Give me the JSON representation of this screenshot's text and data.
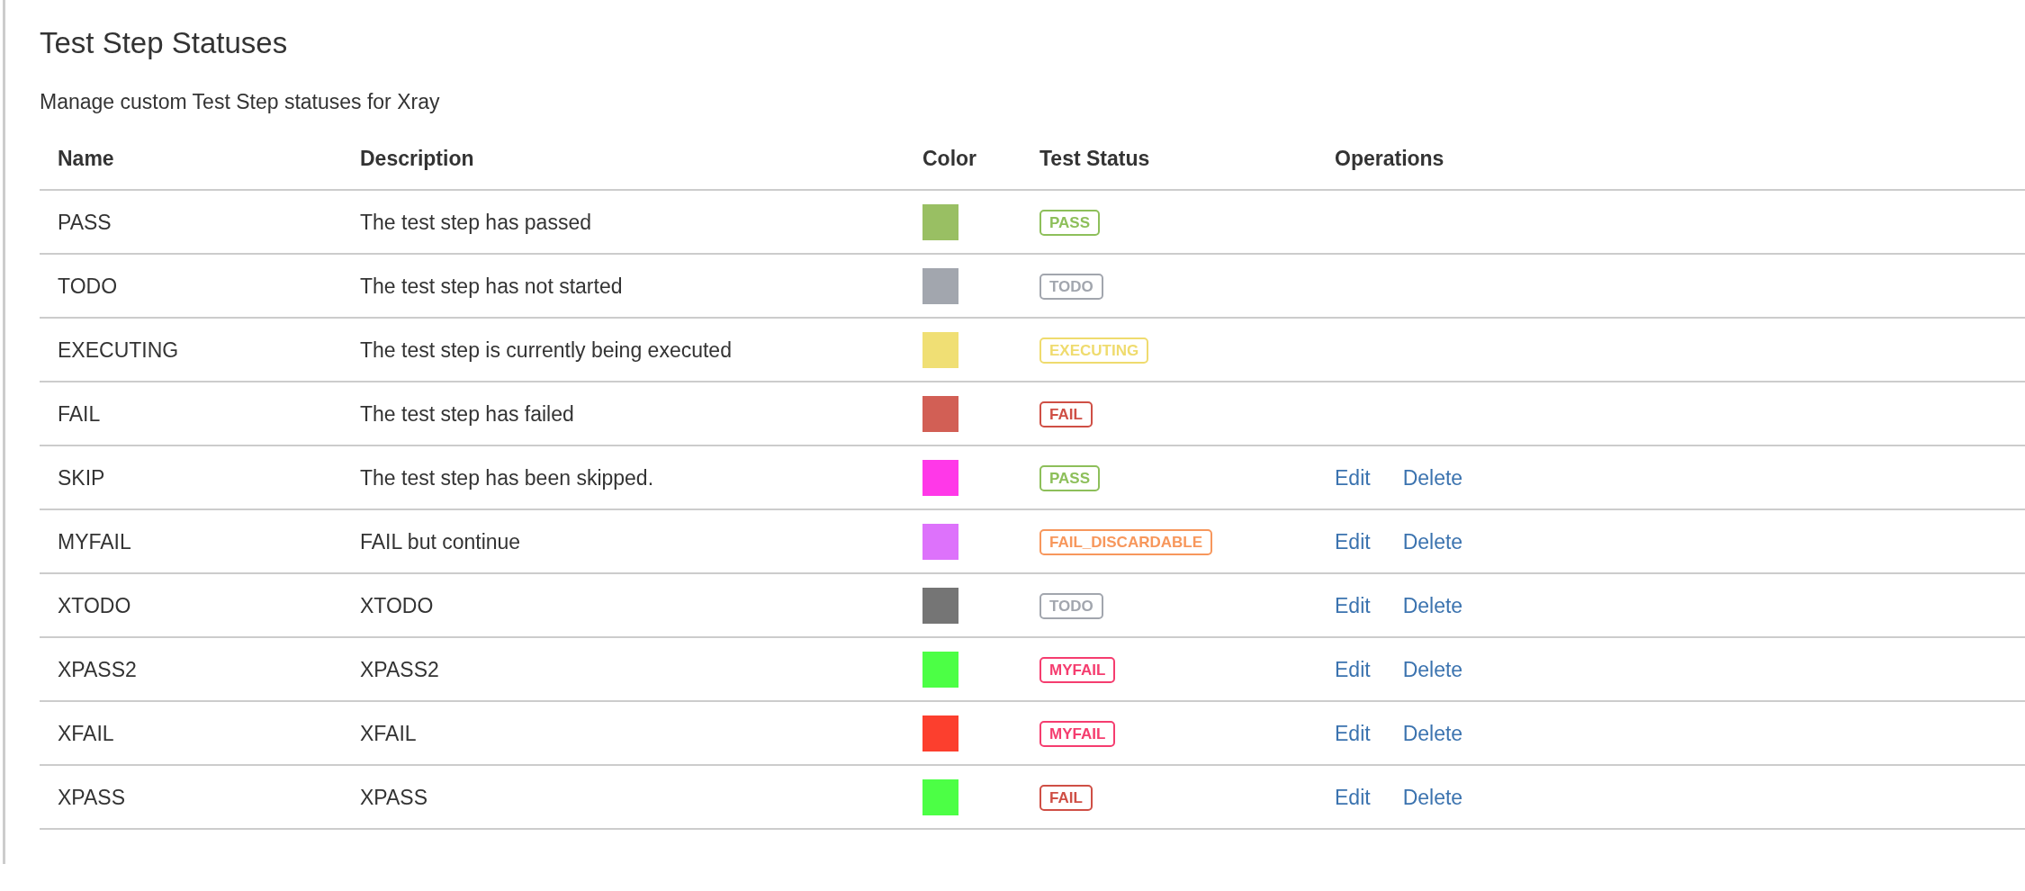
{
  "title": "Test Step Statuses",
  "subtitle": "Manage custom Test Step statuses for Xray",
  "table": {
    "columns": [
      "Name",
      "Description",
      "Color",
      "Test Status",
      "Operations"
    ],
    "rows": [
      {
        "name": "PASS",
        "description": "The test step has passed",
        "color": "#99bf63",
        "test_status": {
          "label": "PASS",
          "color": "#8dbf5a"
        },
        "operations": []
      },
      {
        "name": "TODO",
        "description": "The test step has not started",
        "color": "#a2a6ae",
        "test_status": {
          "label": "TODO",
          "color": "#a2a6ae"
        },
        "operations": []
      },
      {
        "name": "EXECUTING",
        "description": "The test step is currently being executed",
        "color": "#f0df74",
        "test_status": {
          "label": "EXECUTING",
          "color": "#efdb6e"
        },
        "operations": []
      },
      {
        "name": "FAIL",
        "description": "The test step has failed",
        "color": "#d25f55",
        "test_status": {
          "label": "FAIL",
          "color": "#cf4f45"
        },
        "operations": []
      },
      {
        "name": "SKIP",
        "description": "The test step has been skipped.",
        "color": "#ff38e8",
        "test_status": {
          "label": "PASS",
          "color": "#8dbf5a"
        },
        "operations": [
          "Edit",
          "Delete"
        ]
      },
      {
        "name": "MYFAIL",
        "description": "FAIL but continue",
        "color": "#dd72fb",
        "test_status": {
          "label": "FAIL_DISCARDABLE",
          "color": "#f7975c"
        },
        "operations": [
          "Edit",
          "Delete"
        ]
      },
      {
        "name": "XTODO",
        "description": "XTODO",
        "color": "#757575",
        "test_status": {
          "label": "TODO",
          "color": "#a2a6ae"
        },
        "operations": [
          "Edit",
          "Delete"
        ]
      },
      {
        "name": "XPASS2",
        "description": "XPASS2",
        "color": "#4cff45",
        "test_status": {
          "label": "MYFAIL",
          "color": "#f53d6f"
        },
        "operations": [
          "Edit",
          "Delete"
        ]
      },
      {
        "name": "XFAIL",
        "description": "XFAIL",
        "color": "#fc3f2e",
        "test_status": {
          "label": "MYFAIL",
          "color": "#f53d6f"
        },
        "operations": [
          "Edit",
          "Delete"
        ]
      },
      {
        "name": "XPASS",
        "description": "XPASS",
        "color": "#4cff45",
        "test_status": {
          "label": "FAIL",
          "color": "#cf4f45"
        },
        "operations": [
          "Edit",
          "Delete"
        ]
      }
    ]
  }
}
